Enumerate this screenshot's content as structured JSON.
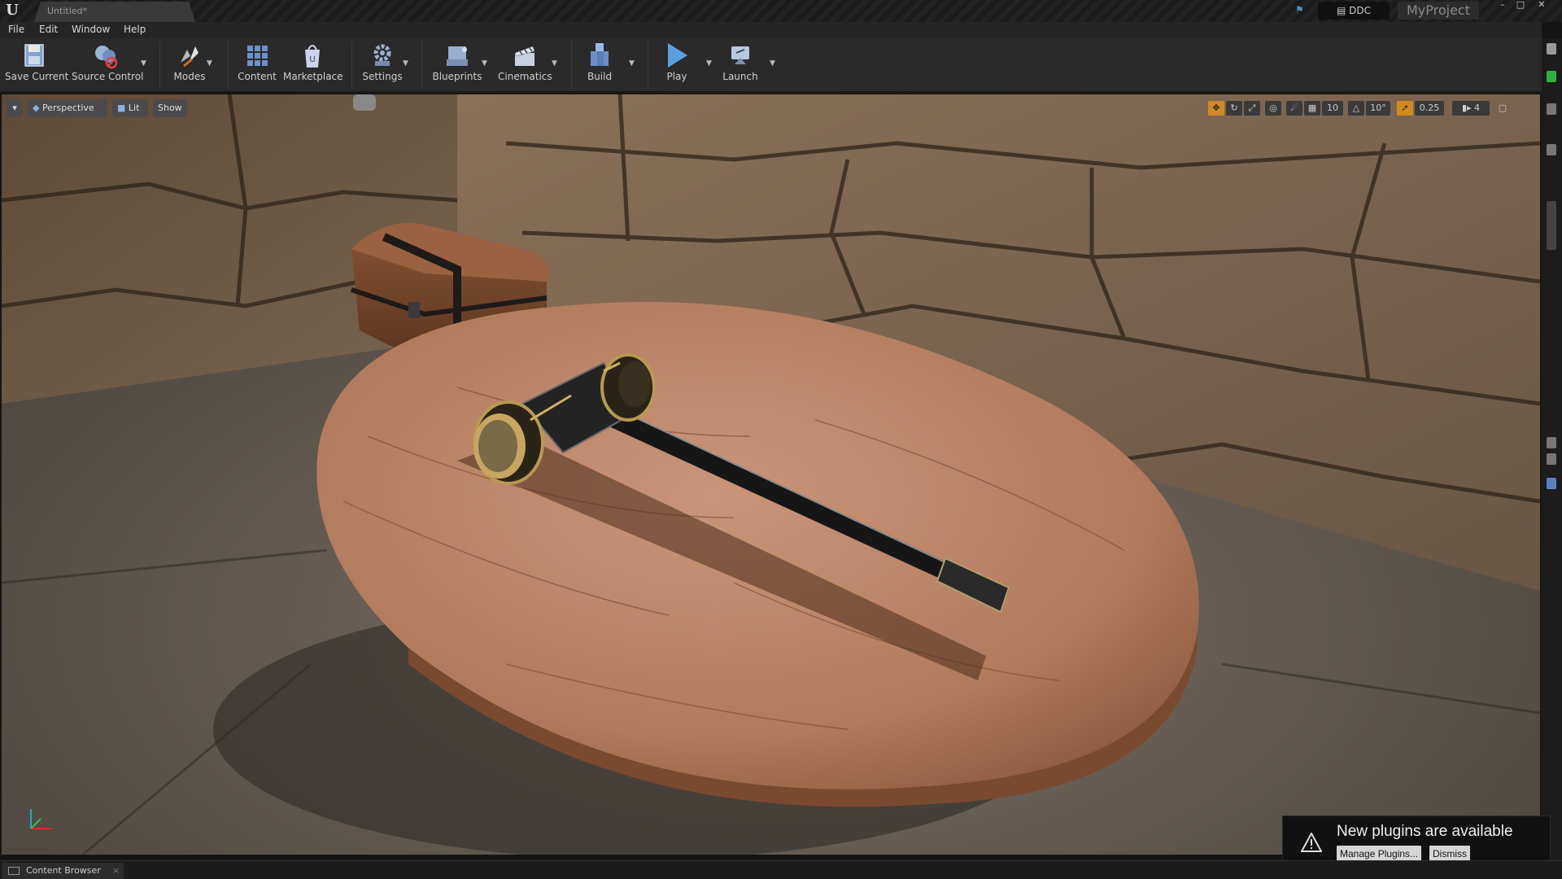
{
  "titlebar": {
    "logo": "U",
    "doc_tab": "Untitled*",
    "ddc_label": "DDC",
    "project_name": "MyProject",
    "window_buttons": [
      "–",
      "□",
      "✕"
    ]
  },
  "menu": [
    "File",
    "Edit",
    "Window",
    "Help"
  ],
  "toolbar": {
    "items": [
      {
        "label": "Save Current",
        "icon": "save-icon"
      },
      {
        "label": "Source Control",
        "icon": "source-control-icon"
      },
      {
        "label": "Modes",
        "icon": "modes-icon"
      },
      {
        "label": "Content",
        "icon": "content-icon"
      },
      {
        "label": "Marketplace",
        "icon": "marketplace-icon"
      },
      {
        "label": "Settings",
        "icon": "settings-icon"
      },
      {
        "label": "Blueprints",
        "icon": "blueprints-icon"
      },
      {
        "label": "Cinematics",
        "icon": "cinematics-icon"
      },
      {
        "label": "Build",
        "icon": "build-icon"
      },
      {
        "label": "Play",
        "icon": "play-icon"
      },
      {
        "label": "Launch",
        "icon": "launch-icon"
      }
    ]
  },
  "viewport": {
    "perspective": "Perspective",
    "lit": "Lit",
    "show": "Show",
    "grid_snap": "10",
    "rotation_snap": "10°",
    "scale_snap": "0.25",
    "camera_speed": "4"
  },
  "notification": {
    "title": "New plugins are available",
    "manage_button": "Manage Plugins...",
    "dismiss_button": "Dismiss"
  },
  "bottom": {
    "content_browser_tab": "Content Browser"
  },
  "colors": {
    "accent_orange": "#f0a020",
    "play_blue": "#5aa0e0",
    "background": "#2a2a2a"
  }
}
